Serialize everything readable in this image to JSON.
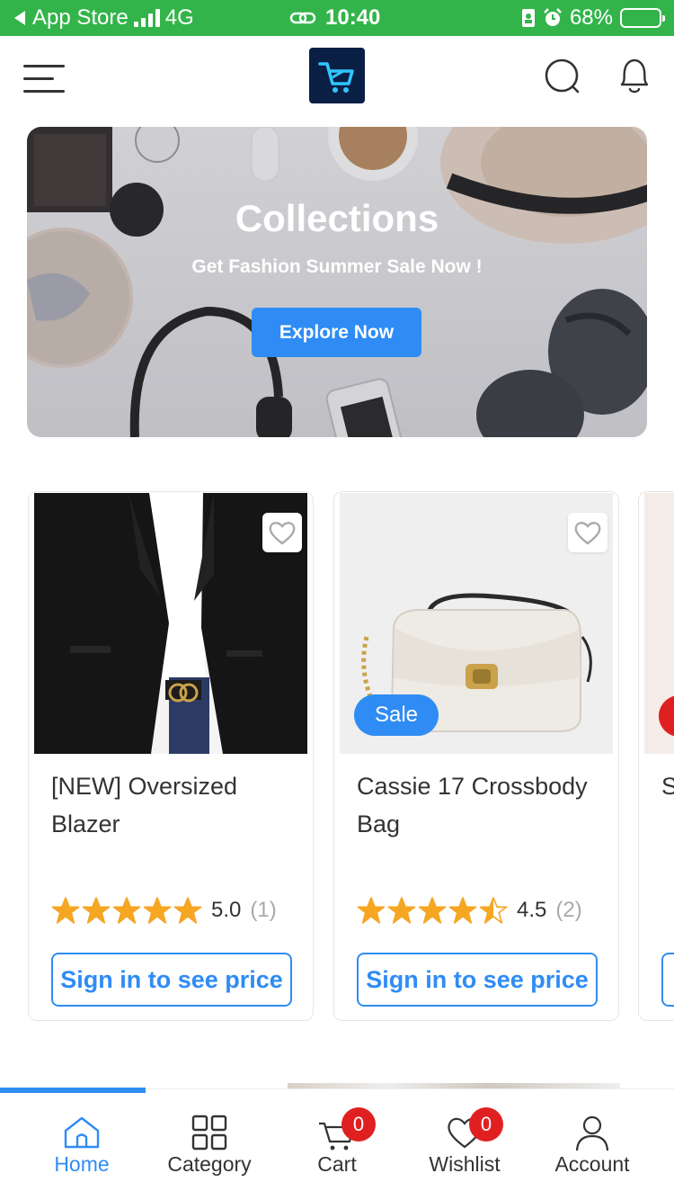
{
  "status_bar": {
    "back_app": "App Store",
    "network": "4G",
    "time": "10:40",
    "battery": "68%",
    "battery_level": 0.68
  },
  "colors": {
    "accent": "#2f8cf4",
    "status_bar": "#33b44a",
    "badge": "#e02020",
    "star": "#f5a623",
    "logo_bg": "#0a1f44"
  },
  "header": {
    "menu_icon": "hamburger-menu-icon",
    "logo_icon": "shopping-cart-logo",
    "search_icon": "search-icon",
    "notification_icon": "bell-icon"
  },
  "banner": {
    "title": "Collections",
    "subtitle": "Get Fashion Summer Sale Now !",
    "cta_label": "Explore Now"
  },
  "products": [
    {
      "title": "[NEW] Oversized Blazer",
      "rating": 5.0,
      "rating_text": "5.0",
      "reviews_text": "(1)",
      "price_label": "Sign in to see price",
      "sale": false
    },
    {
      "title": "Cassie 17 Crossbody Bag",
      "rating": 4.5,
      "rating_text": "4.5",
      "reviews_text": "(2)",
      "price_label": "Sign in to see price",
      "sale": true,
      "sale_label": "Sale"
    },
    {
      "title": "S",
      "sale": true
    }
  ],
  "bottom_nav": {
    "items": [
      {
        "label": "Home",
        "icon": "home-icon",
        "active": true
      },
      {
        "label": "Category",
        "icon": "grid-icon"
      },
      {
        "label": "Cart",
        "icon": "cart-icon",
        "badge": "0"
      },
      {
        "label": "Wishlist",
        "icon": "heart-icon",
        "badge": "0"
      },
      {
        "label": "Account",
        "icon": "user-icon"
      }
    ]
  }
}
